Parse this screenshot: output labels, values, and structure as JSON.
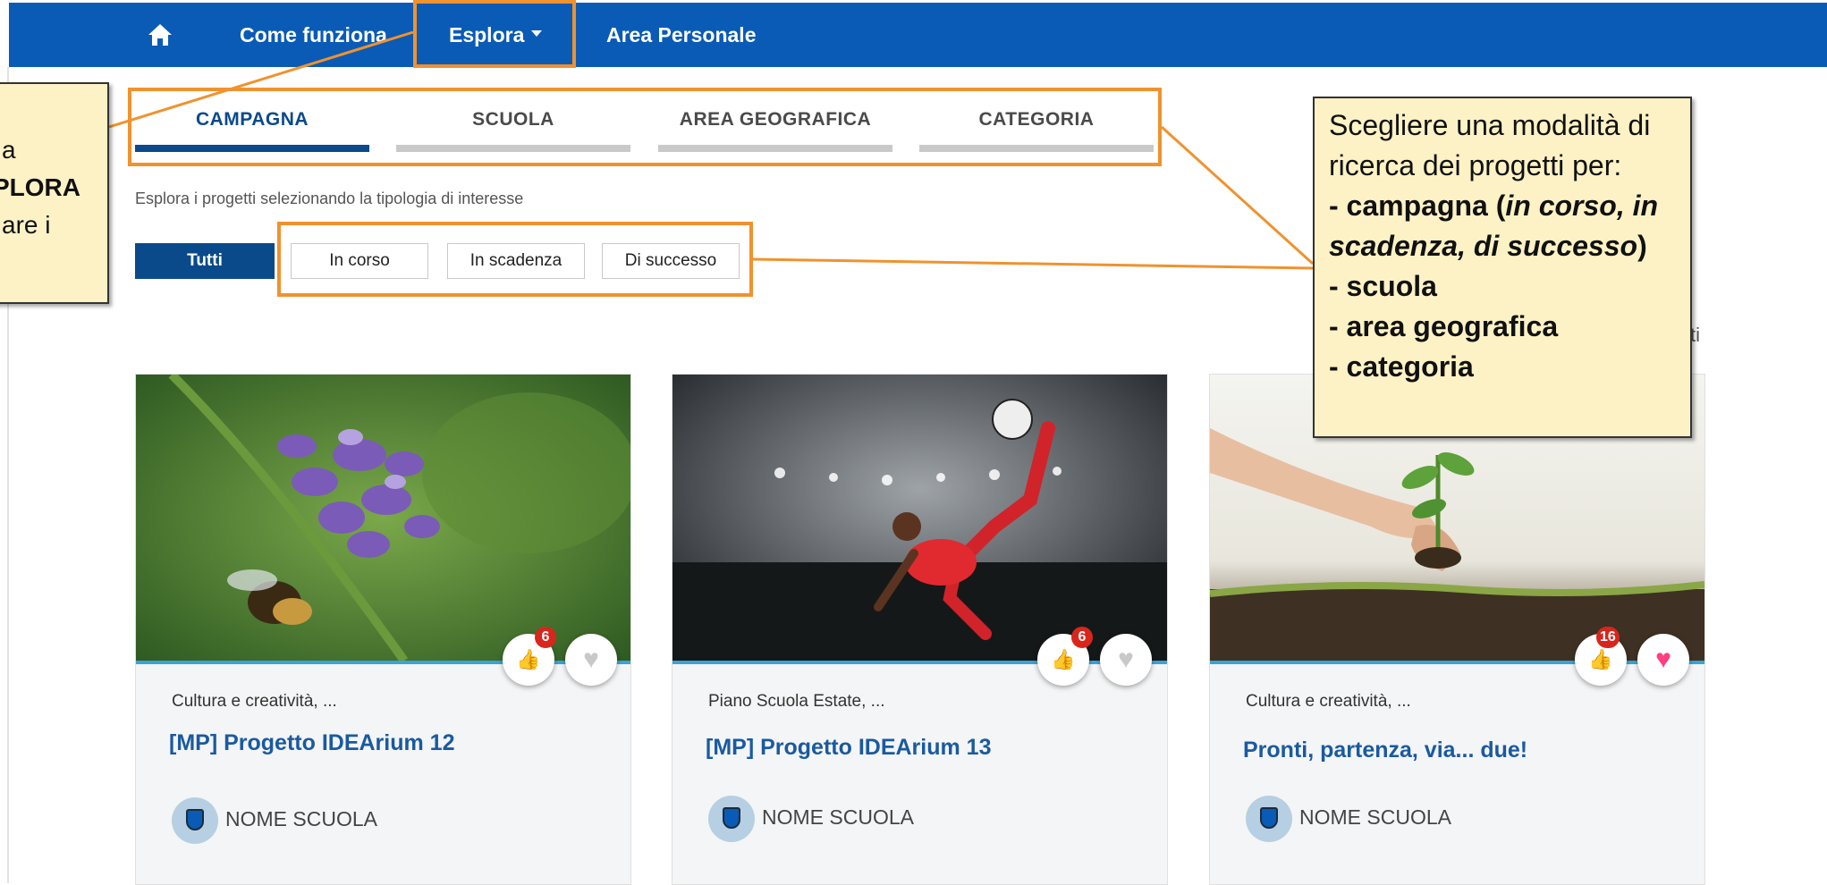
{
  "nav": {
    "home_icon": "home-icon",
    "items": [
      "Come funziona",
      "Esplora",
      "Area Personale"
    ]
  },
  "tabs": [
    {
      "label": "CAMPAGNA",
      "active": true
    },
    {
      "label": "SCUOLA",
      "active": false
    },
    {
      "label": "AREA GEOGRAFICA",
      "active": false
    },
    {
      "label": "CATEGORIA",
      "active": false
    }
  ],
  "helper_text": "Esplora i progetti selezionando la tipologia di interesse",
  "filters": [
    {
      "label": "Tutti",
      "active": true
    },
    {
      "label": "In corso",
      "active": false
    },
    {
      "label": "In scadenza",
      "active": false
    },
    {
      "label": "Di successo",
      "active": false
    }
  ],
  "cards": [
    {
      "category": "Cultura e creatività, ...",
      "title": "[MP] Progetto IDEArium 12",
      "school": "NOME SCUOLA",
      "likes": "6",
      "liked": false
    },
    {
      "category": "Piano Scuola Estate, ...",
      "title": "[MP] Progetto IDEArium 13",
      "school": "NOME SCUOLA",
      "likes": "6",
      "liked": false
    },
    {
      "category": "Cultura e creatività, ...",
      "title": "Pronti, partenza, via... due!",
      "school": "NOME SCUOLA",
      "likes": "16",
      "liked": true
    }
  ],
  "partial_text_right": "ti",
  "annotation_left": {
    "line1": "a",
    "line2": "PLORA",
    "line3": "are i"
  },
  "annotation_right": {
    "intro": "Scegliere una modalità di ricerca dei progetti per:",
    "item1_prefix": "- campagna (",
    "item1_italic": "in corso, in scadenza, di successo",
    "item1_suffix": ")",
    "item2": "- scuola",
    "item3": "- area geografica",
    "item4": "- categoria"
  },
  "colors": {
    "nav_bg": "#0a5bb5",
    "accent_dark": "#0a4a8a",
    "annotation_orange": "#f0922e",
    "callout_bg": "#fdf2c5",
    "badge_red": "#d8261d",
    "heart_pink": "#ff3f82"
  }
}
